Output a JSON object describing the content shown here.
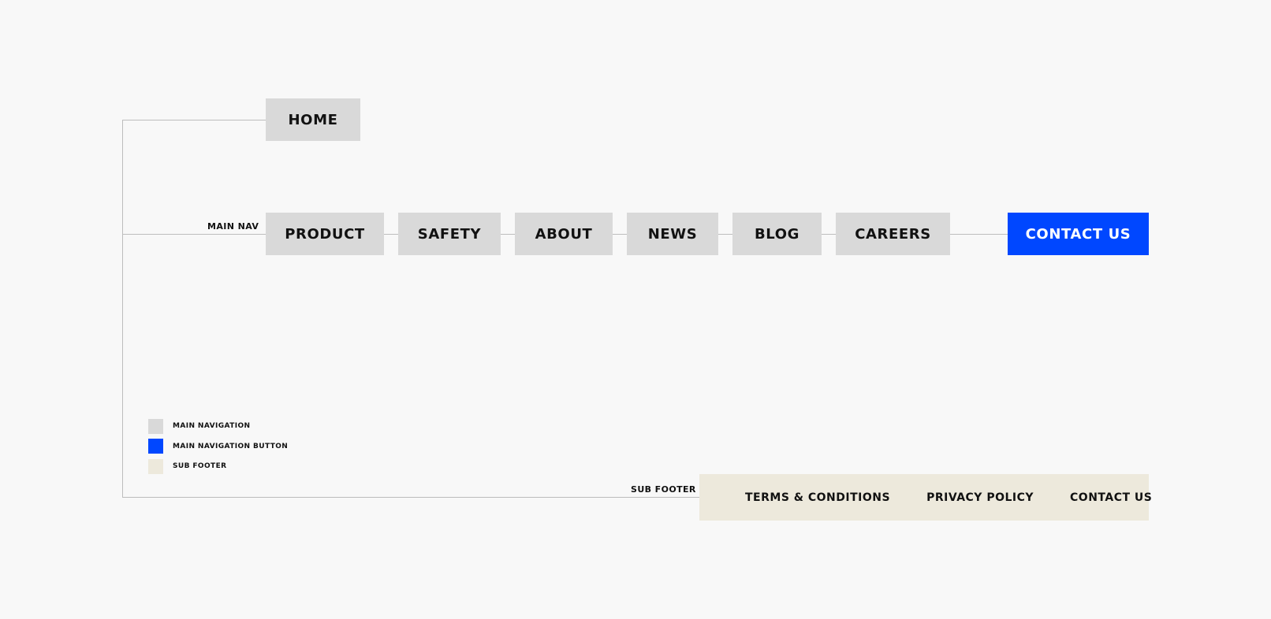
{
  "colors": {
    "background": "#f8f8f8",
    "main_navigation": "#d9d9d9",
    "main_navigation_button": "#0047ff",
    "sub_footer": "#ede9dc",
    "connector_line": "#bdbdbd"
  },
  "home": {
    "label": "HOME"
  },
  "main_nav": {
    "section_label": "MAIN NAV",
    "items": [
      {
        "label": "PRODUCT"
      },
      {
        "label": "SAFETY"
      },
      {
        "label": "ABOUT"
      },
      {
        "label": "NEWS"
      },
      {
        "label": "BLOG"
      },
      {
        "label": "CAREERS"
      }
    ],
    "button": {
      "label": "CONTACT US"
    }
  },
  "sub_footer": {
    "section_label": "SUB FOOTER",
    "links": [
      {
        "label": "TERMS & CONDITIONS"
      },
      {
        "label": "PRIVACY POLICY"
      },
      {
        "label": "CONTACT US"
      }
    ]
  },
  "legend": {
    "items": [
      {
        "label": "MAIN NAVIGATION",
        "color": "#d9d9d9"
      },
      {
        "label": "MAIN NAVIGATION BUTTON",
        "color": "#0047ff"
      },
      {
        "label": "SUB FOOTER",
        "color": "#ede9dc"
      }
    ]
  }
}
